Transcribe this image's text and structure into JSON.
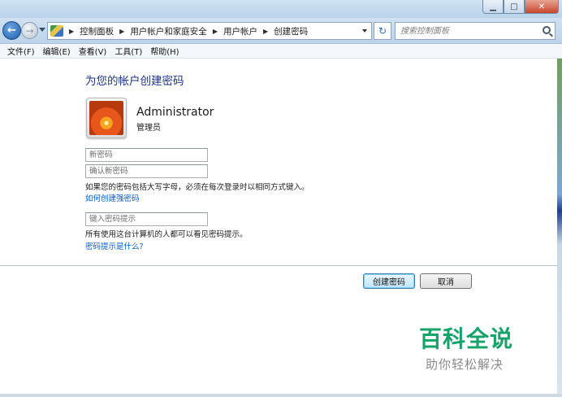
{
  "window": {
    "controls": {
      "minimize": "▁",
      "maximize": "□",
      "close": "✕"
    }
  },
  "navigation": {
    "back_icon": "back-arrow-icon",
    "forward_icon": "forward-arrow-icon",
    "breadcrumbs": [
      "控制面板",
      "用户帐户和家庭安全",
      "用户帐户",
      "创建密码"
    ],
    "search_placeholder": "搜索控制面板"
  },
  "menu": [
    "文件(F)",
    "编辑(E)",
    "查看(V)",
    "工具(T)",
    "帮助(H)"
  ],
  "main": {
    "title": "为您的帐户创建密码",
    "user": {
      "name": "Administrator",
      "role": "管理员"
    },
    "fields": {
      "new_password_placeholder": "新密码",
      "confirm_password_placeholder": "确认新密码",
      "hint_placeholder": "键入密码提示"
    },
    "case_notice": "如果您的密码包括大写字母，必须在每次登录时以相同方式键入。",
    "strong_password_link": "如何创建强密码",
    "hint_notice": "所有使用这台计算机的人都可以看见密码提示。",
    "hint_link": "密码提示是什么?"
  },
  "buttons": {
    "create": "创建密码",
    "cancel": "取消"
  },
  "watermark": {
    "main": "百科全说",
    "sub": "助你轻松解决"
  },
  "colors": {
    "title": "#1e3287",
    "link": "#0a5ec8",
    "watermark": "#16a36a"
  }
}
